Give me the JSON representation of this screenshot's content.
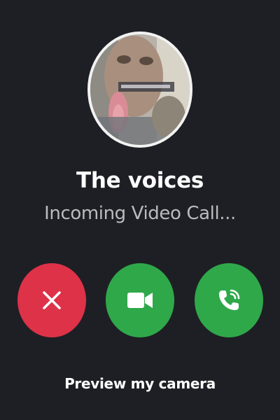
{
  "caller": {
    "name": "The voices",
    "status": "Incoming Video Call..."
  },
  "actions": {
    "decline_icon": "close-icon",
    "video_icon": "video-camera-icon",
    "voice_icon": "phone-icon",
    "preview_label": "Preview my camera"
  },
  "colors": {
    "background": "#1e1f24",
    "decline": "#dd3248",
    "accept": "#2fa84a",
    "status_text": "#b9bbbe"
  }
}
